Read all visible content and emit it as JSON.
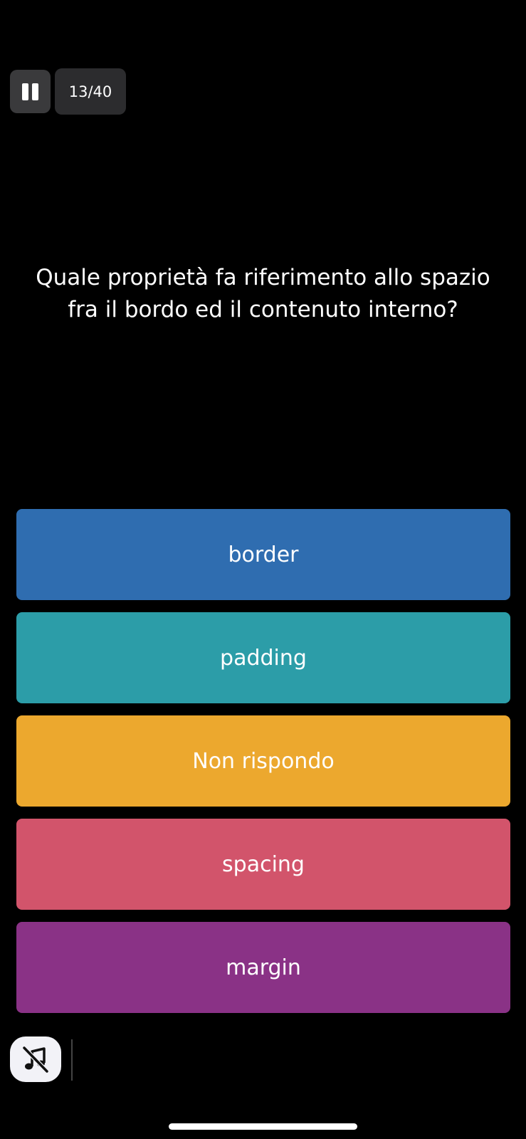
{
  "header": {
    "counter": "13/40",
    "pause_icon": "pause-icon"
  },
  "question": {
    "text": "Quale proprietà fa riferimento allo spazio fra il bordo ed il contenuto interno?"
  },
  "answers": [
    {
      "label": "border",
      "color": "#2f6db0"
    },
    {
      "label": "padding",
      "color": "#2c9da8"
    },
    {
      "label": "Non rispondo",
      "color": "#eca82e"
    },
    {
      "label": "spacing",
      "color": "#d2546b"
    },
    {
      "label": "margin",
      "color": "#8a3286"
    }
  ],
  "footer": {
    "sound_icon": "music-muted-icon"
  }
}
